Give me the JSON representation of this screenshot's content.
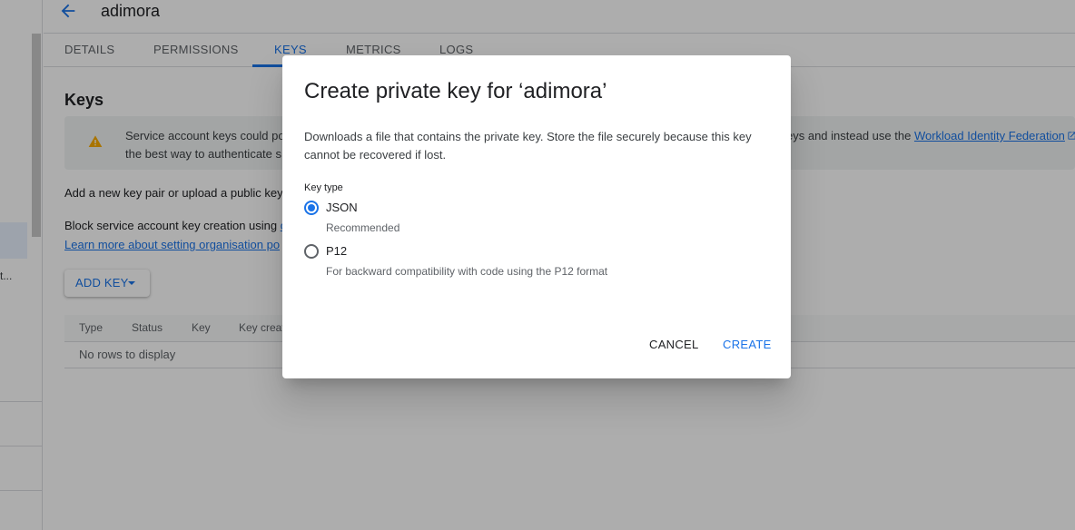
{
  "header": {
    "title": "adimora"
  },
  "tabs": [
    {
      "label": "DETAILS"
    },
    {
      "label": "PERMISSIONS"
    },
    {
      "label": "KEYS",
      "active": true
    },
    {
      "label": "METRICS"
    },
    {
      "label": "LOGS"
    }
  ],
  "sidebar": {
    "truncated_item": "t..."
  },
  "keys_section": {
    "title": "Keys",
    "warning_text_line1": "Service account keys could po",
    "warning_text_line2": "the best way to authenticate s",
    "warning_text_right": "eys and instead use the",
    "warning_link": "Workload Identity Federation",
    "add_key_text": "Add a new key pair or upload a public key",
    "block_text": "Block service account key creation using",
    "block_link_fragment": "o",
    "learn_more_link": "Learn more about setting organisation po",
    "add_key_button": "ADD KEY"
  },
  "table": {
    "columns": [
      "Type",
      "Status",
      "Key",
      "Key creat"
    ],
    "empty_message": "No rows to display"
  },
  "dialog": {
    "title": "Create private key for ‘adimora’",
    "description": "Downloads a file that contains the private key. Store the file securely because this key cannot be recovered if lost.",
    "key_type_label": "Key type",
    "options": [
      {
        "label": "JSON",
        "sublabel": "Recommended",
        "selected": true
      },
      {
        "label": "P12",
        "sublabel": "For backward compatibility with code using the P12 format",
        "selected": false
      }
    ],
    "cancel_label": "CANCEL",
    "create_label": "CREATE"
  },
  "colors": {
    "accent": "#1a73e8",
    "warning": "#f9ab00",
    "scrim": "rgba(0,0,0,0.32)"
  }
}
